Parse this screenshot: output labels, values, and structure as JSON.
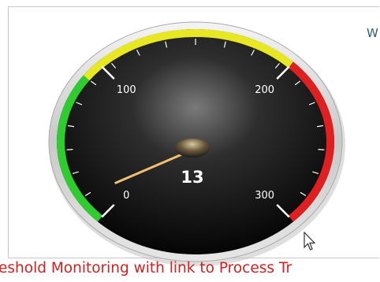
{
  "header_text": "W",
  "gauge": {
    "value": 13,
    "value_label": "13",
    "min": 0,
    "max": 300,
    "ticks": [
      "0",
      "100",
      "200",
      "300"
    ],
    "bands": [
      {
        "from": 0,
        "to": 90,
        "color": "#2ecc2e"
      },
      {
        "from": 90,
        "to": 200,
        "color": "#e8e822"
      },
      {
        "from": 200,
        "to": 300,
        "color": "#e02020"
      }
    ],
    "needle_color": "#f0c070"
  },
  "caption": "eshold Monitoring with link to Process Tr",
  "colors": {
    "caption": "#d02020",
    "corner_text": "#2b5f7a"
  }
}
